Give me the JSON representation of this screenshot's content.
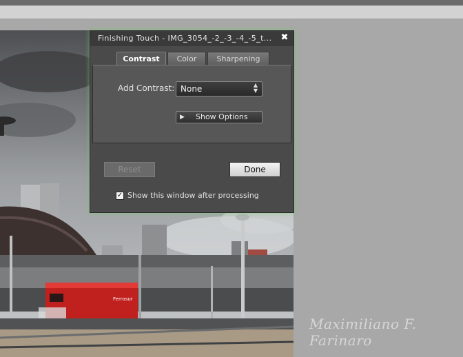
{
  "dialog": {
    "title": "Finishing Touch - IMG_3054_-2_-3_-4_-5_t...",
    "close_glyph": "✖",
    "tabs": [
      {
        "label": "Contrast",
        "active": true
      },
      {
        "label": "Color",
        "active": false
      },
      {
        "label": "Sharpening",
        "active": false
      }
    ],
    "add_contrast_label": "Add Contrast:",
    "add_contrast_value": "None",
    "show_options_label": "Show Options",
    "reset_label": "Reset",
    "reset_enabled": false,
    "done_label": "Done",
    "show_window_label": "Show this window after processing",
    "show_window_checked": true
  },
  "photo": {
    "signature": "Maximiliano F. Farinaro",
    "train_text": "Ferrosur"
  },
  "colors": {
    "accent_glow": "#78c86e",
    "background": "#a8a8a8",
    "train_red": "#c0201e"
  }
}
